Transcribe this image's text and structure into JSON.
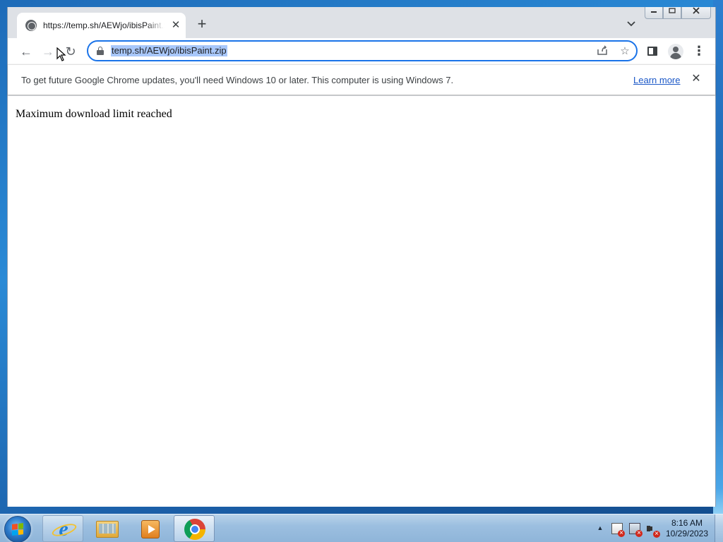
{
  "browser": {
    "tab": {
      "title": "https://temp.sh/AEWjo/ibisPaint.zip",
      "favicon": "globe-icon"
    },
    "new_tab_label": "+",
    "omnibox": {
      "url": "temp.sh/AEWjo/ibisPaint.zip",
      "selection_color": "#a8c7fa",
      "focus_color": "#1a73e8"
    },
    "infobar": {
      "message": "To get future Google Chrome updates, you'll need Windows 10 or later. This computer is using Windows 7.",
      "link": "Learn more"
    },
    "page": {
      "text": "Maximum download limit reached"
    },
    "icons": {
      "back": "←",
      "forward": "→",
      "reload": "↻",
      "share": "⇪",
      "bookmark": "☆",
      "menu": "⋮",
      "close": "✕",
      "tab_search": "⌄"
    }
  },
  "taskbar": {
    "apps": [
      "internet-explorer",
      "windows-explorer",
      "windows-media-player",
      "google-chrome"
    ],
    "clock": {
      "time": "8:16 AM",
      "date": "10/29/2023"
    }
  }
}
